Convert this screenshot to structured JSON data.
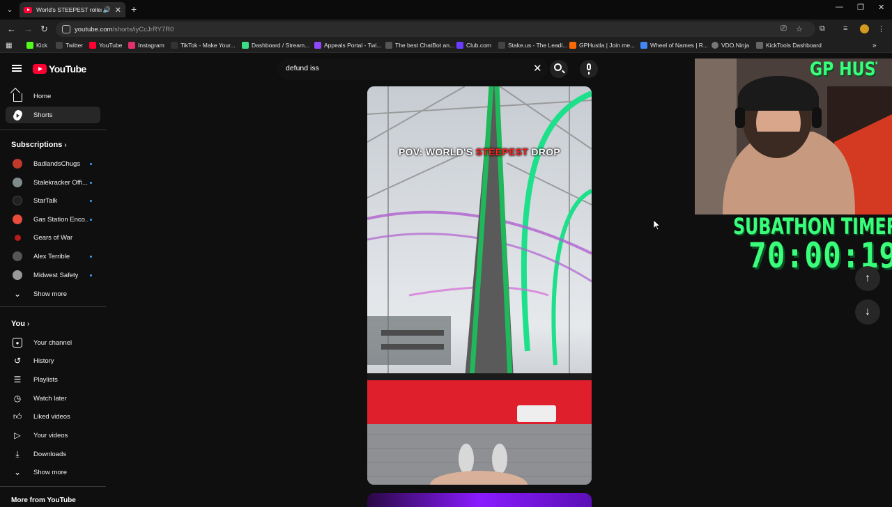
{
  "browser": {
    "tab_title": "World's STEEPEST roller coa",
    "url_host": "youtube.com",
    "url_path": "/shorts/iyCcJrRY7R0",
    "bookmarks": [
      {
        "label": "Kick",
        "color": "#53fc18"
      },
      {
        "label": "Twitter",
        "color": "#ffffff"
      },
      {
        "label": "YouTube",
        "color": "#ff0033"
      },
      {
        "label": "Instagram",
        "color": "#e1306c"
      },
      {
        "label": "TikTok - Make Your...",
        "color": "#ffffff"
      },
      {
        "label": "Dashboard / Stream...",
        "color": "#3ddc84"
      },
      {
        "label": "Appeals Portal - Twi...",
        "color": "#9146ff"
      },
      {
        "label": "The best ChatBot an...",
        "color": "#ffffff"
      },
      {
        "label": "Club.com",
        "color": "#6b3cff"
      },
      {
        "label": "Stake.us - The Leadi...",
        "color": "#ffffff"
      },
      {
        "label": "GPHustla | Join me...",
        "color": "#ff6a00"
      },
      {
        "label": "Wheel of Names | R...",
        "color": "#4285f4"
      },
      {
        "label": "VDO.Ninja",
        "color": "#ffffff"
      },
      {
        "label": "KickTools Dashboard",
        "color": "#ffffff"
      }
    ]
  },
  "youtube": {
    "logo_text": "YouTube",
    "search_value": "defund iss",
    "nav": {
      "home": "Home",
      "shorts": "Shorts"
    },
    "subscriptions_header": "Subscriptions",
    "subscriptions": [
      {
        "label": "BadlandsChugs",
        "color": "#c0392b",
        "new": true
      },
      {
        "label": "Stalekracker Offi...",
        "color": "#7f8c8d",
        "new": true
      },
      {
        "label": "StarTalk",
        "color": "#222222",
        "new": true
      },
      {
        "label": "Gas Station Enco...",
        "color": "#e74c3c",
        "new": true
      },
      {
        "label": "Gears of War",
        "color": "#b71c1c",
        "new": false
      },
      {
        "label": "Alex Terrible",
        "color": "#555555",
        "new": true
      },
      {
        "label": "Midwest Safety",
        "color": "#999999",
        "new": true
      }
    ],
    "show_more": "Show more",
    "you_header": "You",
    "you_items": [
      {
        "label": "Your channel",
        "icon": "person-icon"
      },
      {
        "label": "History",
        "icon": "history-icon"
      },
      {
        "label": "Playlists",
        "icon": "playlists-icon"
      },
      {
        "label": "Watch later",
        "icon": "clock-icon"
      },
      {
        "label": "Liked videos",
        "icon": "thumbs-up-icon"
      },
      {
        "label": "Your videos",
        "icon": "video-icon"
      },
      {
        "label": "Downloads",
        "icon": "download-icon"
      }
    ],
    "show_more_2": "Show more",
    "more_from_youtube": "More from YouTube",
    "short": {
      "overlay_pre": "POV: WORLD'S ",
      "overlay_hot": "STEEPEST",
      "overlay_post": " DROP"
    }
  },
  "stream_overlay": {
    "channel": "GP HUSTLA",
    "timer_label": "SUBATHON TIMER",
    "timer_value": "70:00:19",
    "accent": "#39ff7a"
  }
}
